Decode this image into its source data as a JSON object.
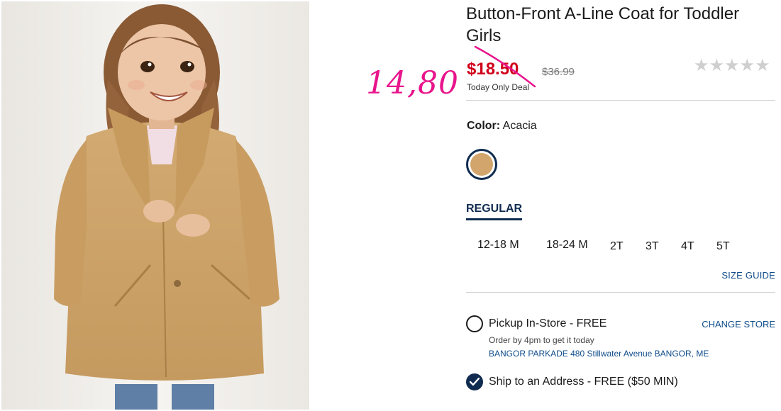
{
  "product": {
    "title": "Button-Front A-Line Coat for Toddler Girls",
    "sale_price": "$18.50",
    "regular_price": "$36.99",
    "deal_label": "Today Only Deal",
    "rating_stars": "★★★★★"
  },
  "annotation": {
    "handwritten_price": "14,80",
    "color": "#e8148c"
  },
  "color": {
    "label": "Color:",
    "value": "Acacia",
    "swatch_color": "#d1a56b"
  },
  "size": {
    "fit_tab": "REGULAR",
    "options": [
      "12-18 M",
      "18-24 M",
      "2T",
      "3T",
      "4T",
      "5T"
    ],
    "guide_link": "SIZE GUIDE"
  },
  "fulfillment": {
    "pickup_label": "Pickup In-Store - FREE",
    "change_store": "CHANGE STORE",
    "order_note": "Order by 4pm to get it today",
    "store_address": "BANGOR PARKADE 480 Stillwater Avenue  BANGOR, ME",
    "ship_label": "Ship to an Address - FREE ($50 MIN)"
  },
  "icons": {
    "photo": "product-photo",
    "stars": "rating-stars-icon",
    "check": "check-icon"
  },
  "colors": {
    "brand_navy": "#0f2b4f",
    "sale_red": "#d0021b",
    "link_blue": "#0f4c8a"
  }
}
